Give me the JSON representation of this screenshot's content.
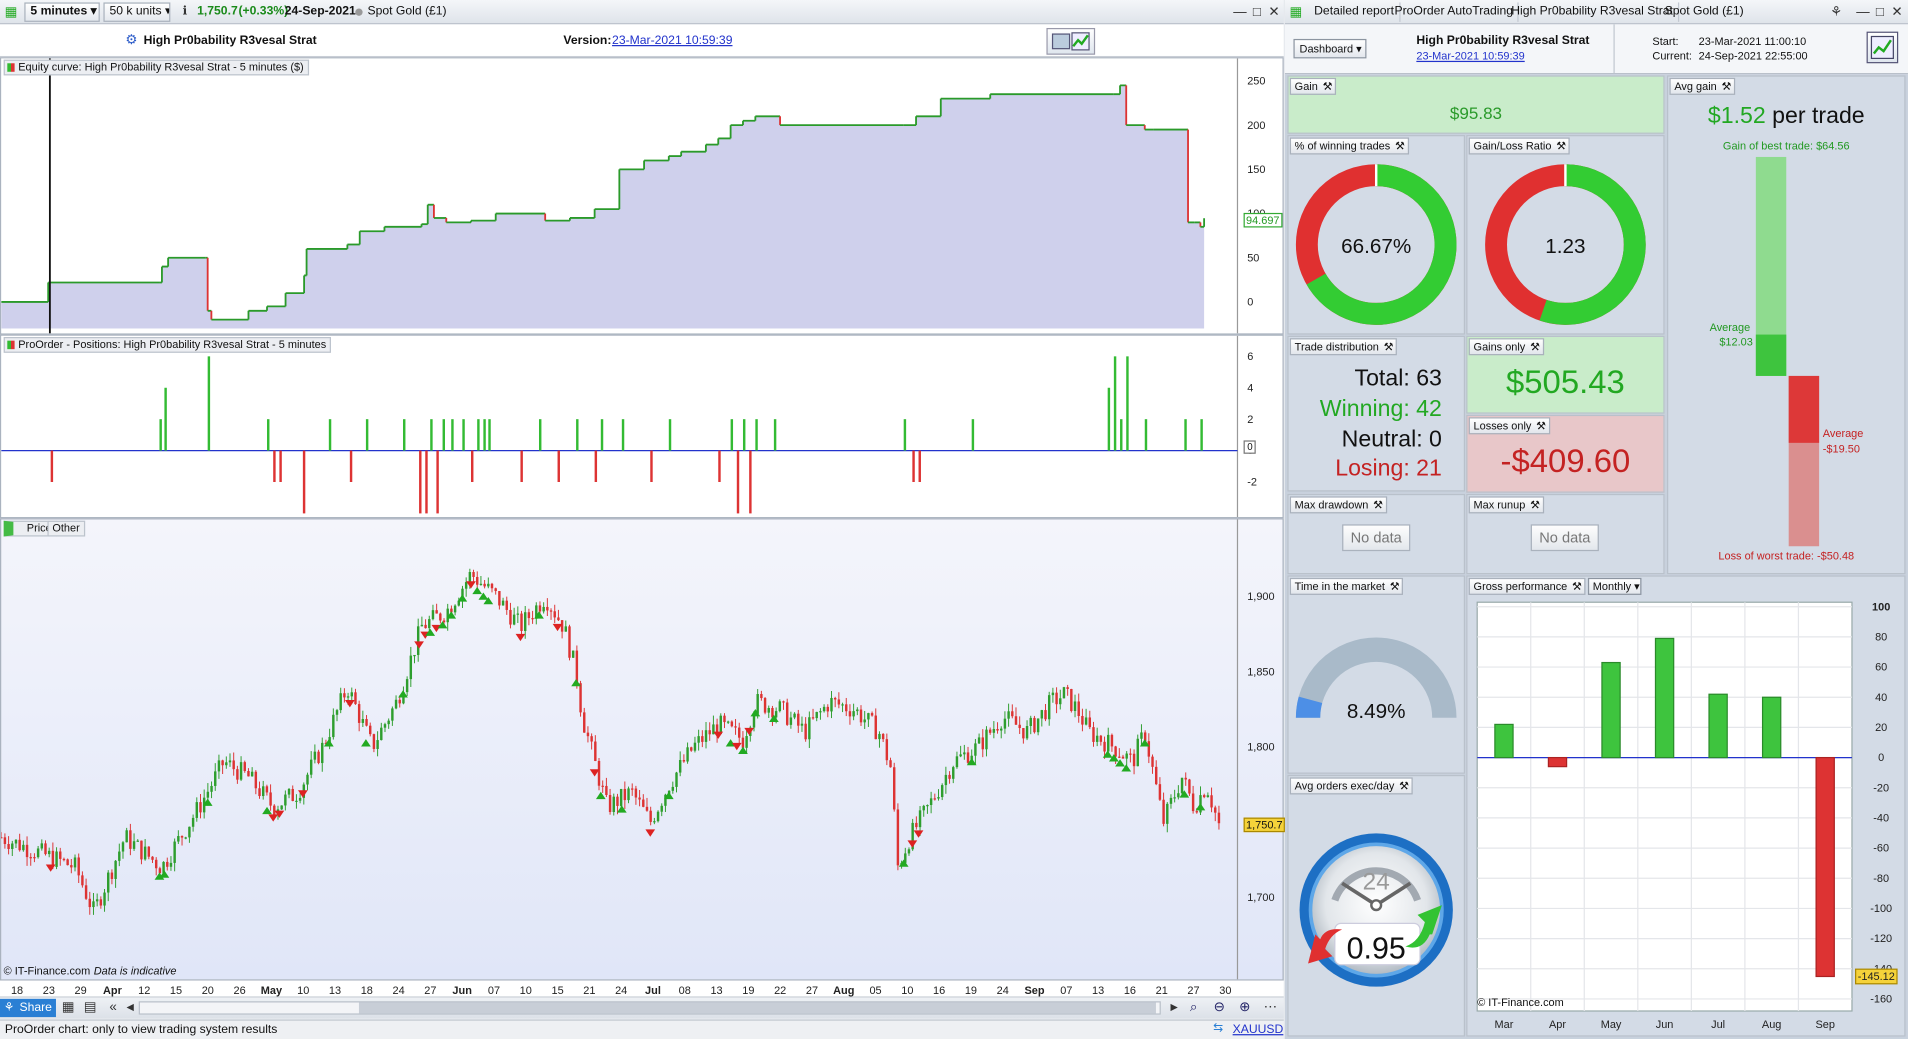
{
  "toolbar": {
    "timeframe": "5 minutes",
    "units": "50 k units",
    "price_value": "1,750.7",
    "price_change": "(+0.33%)",
    "date": "24-Sep-2021",
    "instrument": "Spot Gold (£1)"
  },
  "report_tabs": [
    "Detailed report",
    "ProOrder AutoTrading",
    "High Pr0bability R3vesal Strat",
    "Spot Gold (£1)"
  ],
  "chart_header": {
    "strategy_name": "High Pr0bability R3vesal Strat",
    "version_label": "Version:",
    "version_date": "23-Mar-2021 10:59:39"
  },
  "equity_panel": {
    "title": "Equity curve: High Pr0bability R3vesal Strat - 5 minutes ($)",
    "last_value": "94.697"
  },
  "positions_panel": {
    "title": "ProOrder - Positions: High Pr0bability R3vesal Strat - 5 minutes",
    "zero_marker": "0"
  },
  "price_panel": {
    "tab_price": "Price",
    "tab_other": "Other",
    "last_price": "1,750.7",
    "source": "© IT-Finance.com",
    "note": "Data is indicative"
  },
  "x_axis_labels": [
    "18",
    "23",
    "29",
    "Apr",
    "12",
    "15",
    "20",
    "26",
    "May",
    "10",
    "13",
    "18",
    "24",
    "27",
    "Jun",
    "07",
    "10",
    "15",
    "21",
    "24",
    "Jul",
    "08",
    "13",
    "19",
    "22",
    "27",
    "Aug",
    "05",
    "10",
    "16",
    "19",
    "24",
    "Sep",
    "07",
    "13",
    "16",
    "21",
    "27",
    "30"
  ],
  "bottom_bar": {
    "share": "Share",
    "status": "ProOrder chart: only to view trading system results",
    "symbol": "XAUUSD"
  },
  "report_header": {
    "dashboard": "Dashboard",
    "strategy_name": "High Pr0bability R3vesal Strat",
    "strategy_date": "23-Mar-2021 10:59:39",
    "start_label": "Start:",
    "start_value": "23-Mar-2021 11:00:10",
    "current_label": "Current:",
    "current_value": "24-Sep-2021 22:55:00"
  },
  "metrics": {
    "gain_title": "Gain",
    "gain_value": "$95.83",
    "avg_gain_title": "Avg gain",
    "avg_gain_value": "$1.52",
    "avg_gain_suffix": "per trade",
    "best_trade": "Gain of best trade: $64.56",
    "avg_win_label": "Average",
    "avg_win_value": "$12.03",
    "avg_loss_label": "Average",
    "avg_loss_value": "-$19.50",
    "worst_trade": "Loss of worst trade: -$50.48",
    "win_pct_title": "% of winning trades",
    "win_pct_value": "66.67%",
    "win_pct": 66.67,
    "gl_ratio_title": "Gain/Loss Ratio",
    "gl_ratio_value": "1.23",
    "gl_ratio_fraction": 0.552,
    "trade_dist_title": "Trade distribution",
    "total": "Total: 63",
    "winning": "Winning: 42",
    "neutral": "Neutral: 0",
    "losing": "Losing: 21",
    "gains_only_title": "Gains only",
    "gains_only_value": "$505.43",
    "losses_only_title": "Losses only",
    "losses_only_value": "-$409.60",
    "max_dd_title": "Max drawdown",
    "max_runup_title": "Max runup",
    "no_data": "No data",
    "time_market_title": "Time in the market",
    "time_market_value": "8.49%",
    "time_market_pct": 8.49,
    "avg_orders_title": "Avg orders exec/day",
    "avg_orders_value": "0.95",
    "gauge_max": "24",
    "gross_perf_title": "Gross performance",
    "gross_perf_period": "Monthly",
    "gross_source": "© IT-Finance.com"
  },
  "colors": {
    "gain_green": "#33cc33",
    "loss_red": "#e03030",
    "equity_fill": "#cfd0ec",
    "panel_bg": "#d3dbe6"
  },
  "chart_data": [
    {
      "type": "line",
      "name": "equity",
      "ylim": [
        -30,
        270
      ],
      "yticks": [
        0,
        50,
        100,
        150,
        200,
        250
      ],
      "x": [
        0,
        0.037,
        0.038,
        0.128,
        0.13,
        0.135,
        0.165,
        0.167,
        0.17,
        0.2,
        0.215,
        0.23,
        0.245,
        0.247,
        0.28,
        0.29,
        0.31,
        0.34,
        0.345,
        0.35,
        0.36,
        0.38,
        0.4,
        0.44,
        0.46,
        0.48,
        0.5,
        0.52,
        0.54,
        0.55,
        0.57,
        0.58,
        0.59,
        0.6,
        0.61,
        0.63,
        0.73,
        0.74,
        0.76,
        0.8,
        0.9,
        0.905,
        0.91,
        0.925,
        0.932,
        0.96,
        0.965,
        0.97,
        0.973
      ],
      "values": [
        0,
        0,
        22,
        22,
        40,
        50,
        50,
        -10,
        -20,
        -10,
        -5,
        10,
        30,
        60,
        65,
        80,
        85,
        88,
        110,
        95,
        90,
        92,
        100,
        92,
        95,
        105,
        150,
        160,
        165,
        170,
        178,
        185,
        200,
        205,
        210,
        200,
        200,
        210,
        230,
        235,
        235,
        245,
        200,
        195,
        195,
        90,
        90,
        85,
        94.7
      ]
    },
    {
      "type": "bar",
      "name": "positions",
      "ylim": [
        -4,
        7
      ],
      "yticks": [
        -2,
        0,
        2,
        4,
        6
      ],
      "x": [
        0.04,
        0.128,
        0.132,
        0.167,
        0.215,
        0.22,
        0.225,
        0.244,
        0.265,
        0.282,
        0.295,
        0.325,
        0.338,
        0.343,
        0.347,
        0.352,
        0.357,
        0.364,
        0.373,
        0.38,
        0.385,
        0.39,
        0.394,
        0.42,
        0.435,
        0.45,
        0.465,
        0.48,
        0.485,
        0.502,
        0.525,
        0.54,
        0.58,
        0.59,
        0.595,
        0.6,
        0.605,
        0.61,
        0.625,
        0.73,
        0.737,
        0.742,
        0.785,
        0.895,
        0.9,
        0.905,
        0.91,
        0.925,
        0.957,
        0.97
      ],
      "values": [
        -2,
        2,
        4,
        6,
        2,
        -2,
        -2,
        -4,
        2,
        -2,
        2,
        2,
        -4,
        -4,
        2,
        -4,
        2,
        2,
        2,
        -2,
        2,
        2,
        2,
        -2,
        2,
        -2,
        2,
        -2,
        2,
        2,
        -2,
        2,
        -2,
        2,
        -4,
        2,
        -4,
        2,
        2,
        2,
        -2,
        -2,
        2,
        4,
        6,
        2,
        6,
        2,
        2,
        2
      ]
    },
    {
      "type": "line",
      "name": "price",
      "ylim": [
        1660,
        1935
      ],
      "yticks": [
        1700,
        1750,
        1800,
        1850,
        1900
      ],
      "x": [
        0,
        0.03,
        0.06,
        0.075,
        0.1,
        0.13,
        0.16,
        0.18,
        0.2,
        0.22,
        0.24,
        0.26,
        0.28,
        0.3,
        0.32,
        0.34,
        0.36,
        0.38,
        0.4,
        0.42,
        0.44,
        0.455,
        0.465,
        0.47,
        0.49,
        0.51,
        0.525,
        0.54,
        0.56,
        0.58,
        0.6,
        0.61,
        0.63,
        0.65,
        0.67,
        0.69,
        0.71,
        0.72,
        0.725,
        0.735,
        0.75,
        0.77,
        0.79,
        0.81,
        0.83,
        0.85,
        0.86,
        0.87,
        0.88,
        0.9,
        0.915,
        0.925,
        0.94,
        0.955,
        0.965,
        0.975,
        0.985
      ],
      "values": [
        1740,
        1730,
        1720,
        1690,
        1740,
        1720,
        1760,
        1790,
        1780,
        1760,
        1770,
        1800,
        1840,
        1800,
        1830,
        1880,
        1890,
        1915,
        1900,
        1880,
        1900,
        1880,
        1850,
        1820,
        1760,
        1770,
        1750,
        1775,
        1800,
        1815,
        1805,
        1830,
        1825,
        1810,
        1830,
        1825,
        1810,
        1785,
        1720,
        1740,
        1760,
        1790,
        1800,
        1820,
        1810,
        1830,
        1835,
        1825,
        1810,
        1800,
        1790,
        1810,
        1750,
        1780,
        1760,
        1775,
        1748
      ]
    },
    {
      "type": "bar",
      "name": "gross-performance",
      "categories": [
        "Mar",
        "Apr",
        "May",
        "Jun",
        "Jul",
        "Aug",
        "Sep"
      ],
      "values": [
        22,
        -6,
        63,
        79,
        42,
        40,
        -145.12
      ],
      "ylim": [
        -168,
        103
      ],
      "yticks": [
        100,
        80,
        60,
        40,
        20,
        0,
        -20,
        -40,
        -60,
        -80,
        -100,
        -120,
        -140,
        -160
      ],
      "last_label": "-145.12"
    }
  ]
}
